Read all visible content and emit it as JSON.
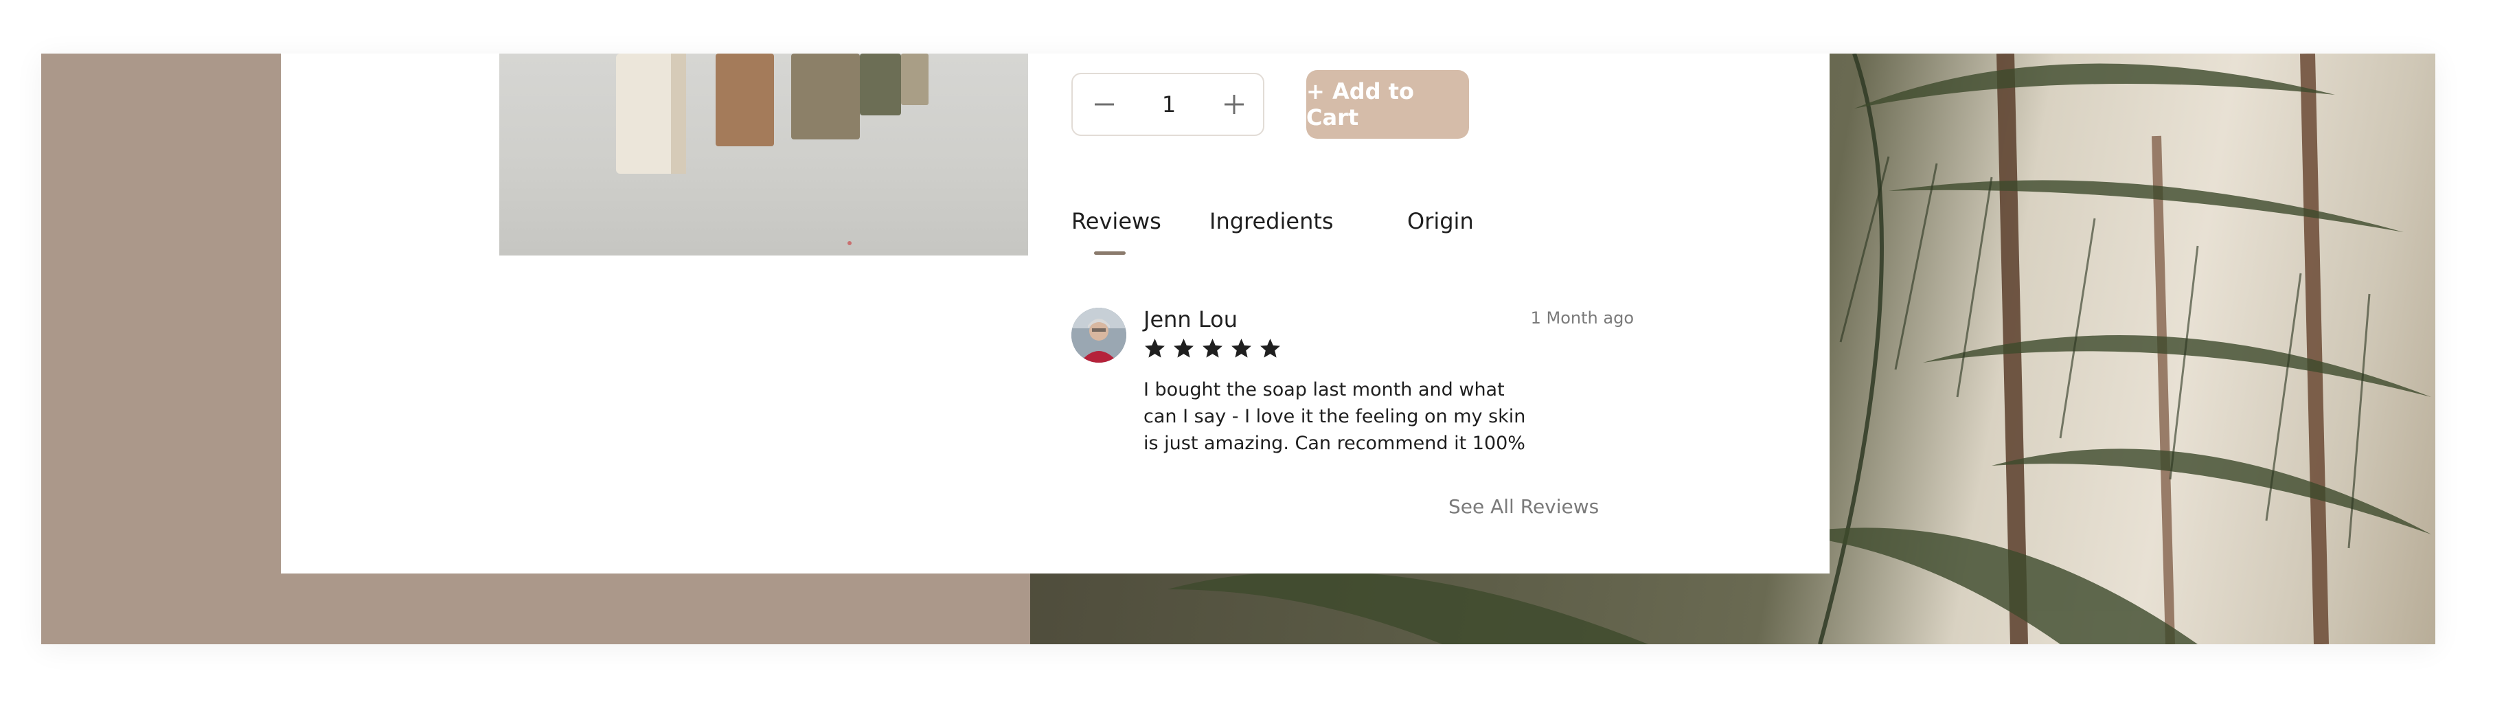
{
  "cart": {
    "decrement_icon": "minus-icon",
    "increment_icon": "plus-icon",
    "quantity": "1",
    "add_label": "+ Add to Cart",
    "add_color": "#d5bca9"
  },
  "tabs": [
    {
      "label": "Reviews",
      "active": true
    },
    {
      "label": "Ingredients",
      "active": false
    },
    {
      "label": "Origin",
      "active": false
    }
  ],
  "review": {
    "name": "Jenn Lou",
    "date": "1 Month ago",
    "rating": 5,
    "rating_max": 5,
    "text": "I bought the soap last month and what can I say - I love it the feeling on my skin is just amazing. Can recommend it 100%"
  },
  "see_all_label": "See All Reviews",
  "colors": {
    "accent": "#d5bca9",
    "backdrop": "#ab988a",
    "tab_indicator": "#8a7a6c"
  }
}
